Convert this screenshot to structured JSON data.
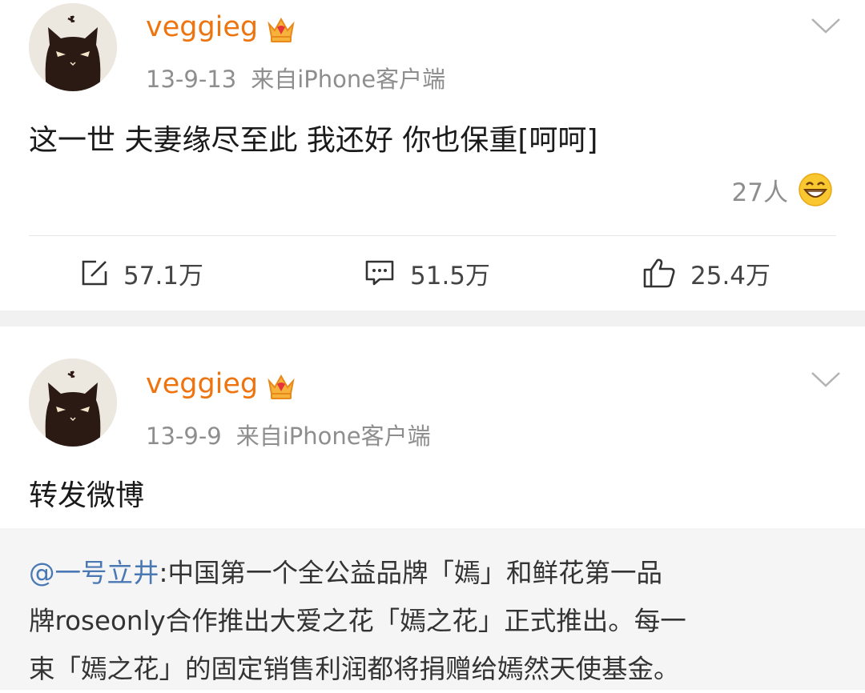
{
  "posts": [
    {
      "username": "veggieg",
      "date": "13-9-13",
      "source": "来自iPhone客户端",
      "text": "这一世 夫妻缘尽至此 我还好 你也保重[呵呵]",
      "reactions": {
        "count": "27人",
        "emoji": "laugh-emoji"
      },
      "actions": {
        "repost": "57.1万",
        "comment": "51.5万",
        "like": "25.4万"
      }
    },
    {
      "username": "veggieg",
      "date": "13-9-9",
      "source": "来自iPhone客户端",
      "text": "转发微博",
      "quoted": {
        "mention": "@一号立井",
        "body_lines": [
          ":中国第一个全公益品牌「嫣」和鲜花第一品",
          "牌roseonly合作推出大爱之花「嫣之花」正式推出。每一",
          "束「嫣之花」的固定销售利润都将捐赠给嫣然天使基金。"
        ]
      }
    }
  ],
  "colors": {
    "username": "#ee7410",
    "meta": "#8e8e8e",
    "mention": "#4a78b5",
    "separator": "#f1f1f1",
    "quote_bg": "#f5f5f5"
  }
}
